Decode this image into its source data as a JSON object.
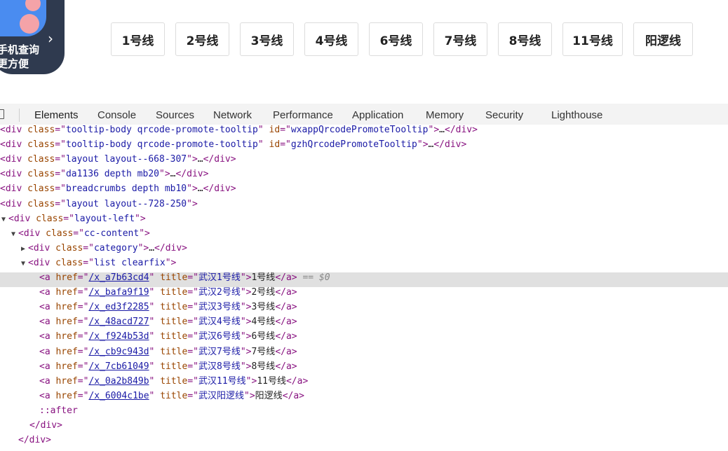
{
  "promo": {
    "line1": "手机查询",
    "line2": "更方便",
    "arrow": "›"
  },
  "line_buttons": [
    {
      "label": "1号线"
    },
    {
      "label": "2号线"
    },
    {
      "label": "3号线"
    },
    {
      "label": "4号线"
    },
    {
      "label": "6号线"
    },
    {
      "label": "7号线"
    },
    {
      "label": "8号线"
    },
    {
      "label": "11号线"
    },
    {
      "label": "阳逻线"
    }
  ],
  "devtools": {
    "tabs": [
      {
        "label": "Elements",
        "active": true
      },
      {
        "label": "Console"
      },
      {
        "label": "Sources"
      },
      {
        "label": "Network"
      },
      {
        "label": "Performance"
      },
      {
        "label": "Application"
      },
      {
        "label": "Memory"
      },
      {
        "label": "Security"
      },
      {
        "label": "Lighthouse"
      }
    ],
    "selected_marker": "== $0",
    "nodes": [
      {
        "kind": "div",
        "cls": "tooltip-body qrcode-promote-tooltip",
        "id": "wxappQrcodePromoteTooltip",
        "ellipsis": true,
        "closed": true
      },
      {
        "kind": "div",
        "cls": "tooltip-body qrcode-promote-tooltip",
        "id": "gzhQrcodePromoteTooltip",
        "ellipsis": true,
        "closed": true
      },
      {
        "kind": "div",
        "cls": "layout layout--668-307",
        "ellipsis": true,
        "closed": true
      },
      {
        "kind": "div",
        "cls": "da1136 depth mb20",
        "ellipsis": true,
        "closed": true
      },
      {
        "kind": "div",
        "cls": "breadcrumbs depth mb10",
        "ellipsis": true,
        "closed": true
      },
      {
        "kind": "div",
        "cls": "layout layout--728-250",
        "ellipsis": false,
        "closed": false
      },
      {
        "kind": "div",
        "cls": "layout-left",
        "toggle": "open"
      },
      {
        "kind": "div",
        "cls": "cc-content",
        "toggle": "open"
      },
      {
        "kind": "div",
        "cls": "category",
        "toggle": "closed",
        "ellipsis": true,
        "closed": true
      },
      {
        "kind": "div",
        "cls": "list clearfix",
        "toggle": "open"
      },
      {
        "kind": "a",
        "href": "/x_a7b63cd4",
        "title": "武汉1号线",
        "text": "1号线",
        "selected": true
      },
      {
        "kind": "a",
        "href": "/x_bafa9f19",
        "title": "武汉2号线",
        "text": "2号线"
      },
      {
        "kind": "a",
        "href": "/x_ed3f2285",
        "title": "武汉3号线",
        "text": "3号线"
      },
      {
        "kind": "a",
        "href": "/x_48acd727",
        "title": "武汉4号线",
        "text": "4号线"
      },
      {
        "kind": "a",
        "href": "/x_f924b53d",
        "title": "武汉6号线",
        "text": "6号线"
      },
      {
        "kind": "a",
        "href": "/x_cb9c943d",
        "title": "武汉7号线",
        "text": "7号线"
      },
      {
        "kind": "a",
        "href": "/x_7cb61049",
        "title": "武汉8号线",
        "text": "8号线"
      },
      {
        "kind": "a",
        "href": "/x_0a2b849b",
        "title": "武汉11号线",
        "text": "11号线"
      },
      {
        "kind": "a",
        "href": "/x_6004c1be",
        "title": "武汉阳逻线",
        "text": "阳逻线"
      },
      {
        "kind": "pseudo",
        "text": "::after"
      },
      {
        "kind": "close",
        "text": "</div>"
      },
      {
        "kind": "close",
        "text": "</div>"
      }
    ]
  }
}
